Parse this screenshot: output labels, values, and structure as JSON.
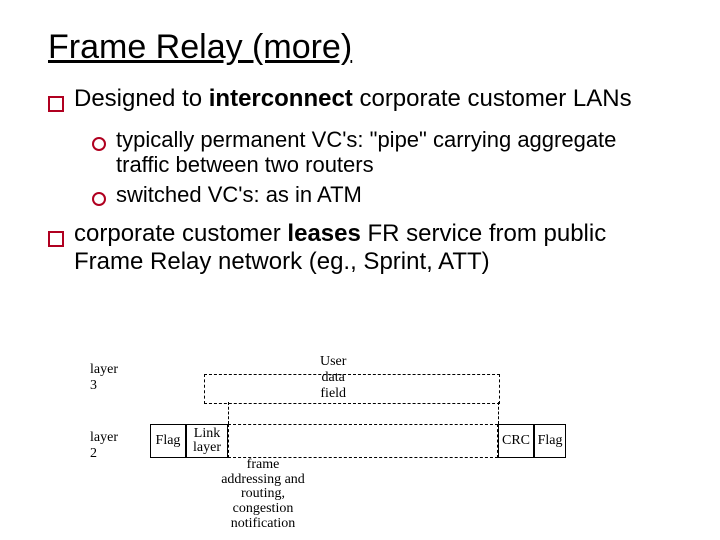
{
  "title": "Frame Relay (more)",
  "bullets": {
    "l1a_pre": "Designed to ",
    "l1a_bold": "interconnect",
    "l1a_post": " corporate customer LANs",
    "l2a": "typically permanent VC's: \"pipe\" carrying aggregate traffic between two routers",
    "l2b": "switched VC's: as in ATM",
    "l1b_pre": "corporate customer ",
    "l1b_bold": "leases",
    "l1b_post": "  FR service from public Frame Relay network (eg., Sprint, ATT)"
  },
  "diagram": {
    "layer3": "layer 3",
    "layer2": "layer 2",
    "user_data": "User data field",
    "flag": "Flag",
    "link_layer": "Link layer",
    "crc": "CRC",
    "frame_label": "frame addressing and routing, congestion notification"
  }
}
